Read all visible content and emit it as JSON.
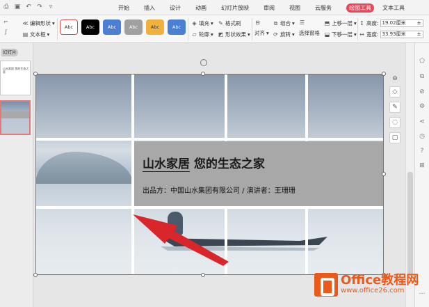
{
  "menu": {
    "tabs": [
      "开始",
      "插入",
      "设计",
      "动画",
      "幻灯片放映",
      "审阅",
      "视图",
      "云服务",
      "绘图工具",
      "文本工具"
    ]
  },
  "ribbon": {
    "edit_shape": "编辑形状",
    "text_box": "文本框",
    "style_labels": [
      "Abc",
      "Abc",
      "Abc",
      "Abc",
      "Abc",
      "Abc"
    ],
    "style_colors": [
      "#ffffff",
      "#000000",
      "#4a7fd4",
      "#a0a0a0",
      "#f2b03d",
      "#4a7fd4"
    ],
    "fill": "填充",
    "format_painter": "格式刷",
    "outline": "轮廓",
    "shape_effect": "形状效果",
    "align": "对齐",
    "group": "组合",
    "rotate": "旋转",
    "selection_pane": "选择窗格",
    "bring_forward": "上移一层",
    "send_backward": "下移一层",
    "height_label": "高度:",
    "height_value": "19.02厘米",
    "width_label": "宽度:",
    "width_value": "33.93厘米"
  },
  "left_panel": {
    "tab_label": "幻灯片",
    "thumb1_text": "山水家居 您的生态之家"
  },
  "slide": {
    "title": "山水家居 您的生态之家",
    "subtitle": "出品方：中国山水集团有限公司 / 演讲者：王珊珊"
  },
  "watermark": {
    "brand": "Office教程网",
    "url": "www.office26.com"
  }
}
